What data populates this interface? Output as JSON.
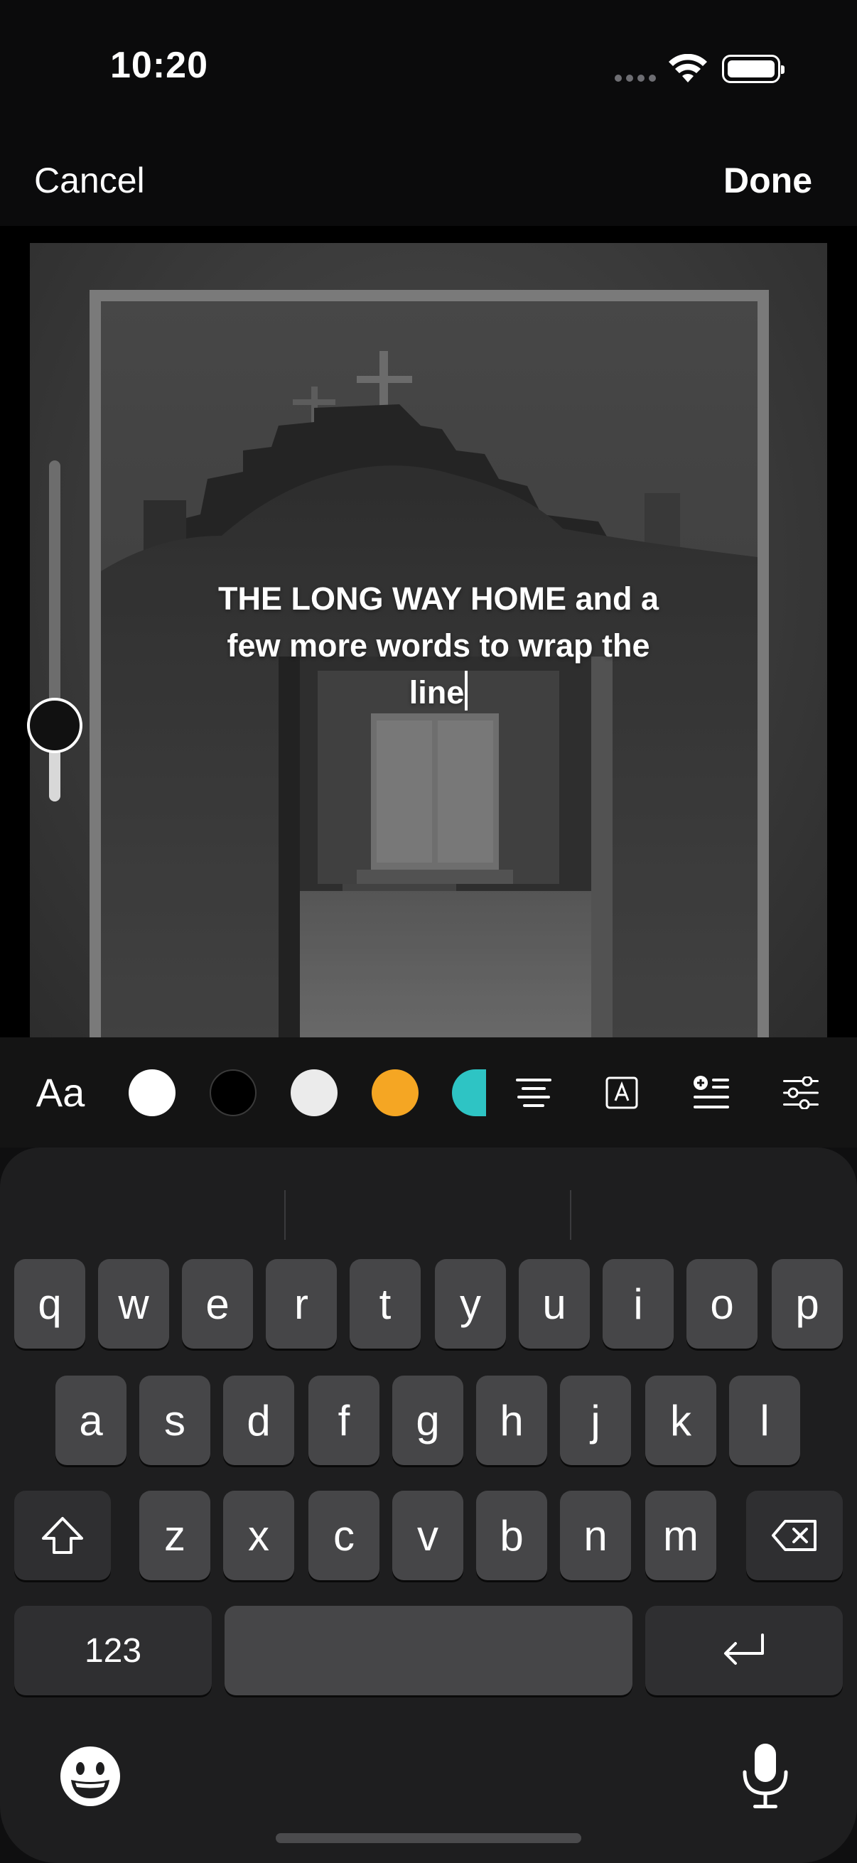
{
  "status_bar": {
    "time": "10:20",
    "icons": [
      "signal-dots-icon",
      "wifi-icon",
      "battery-icon"
    ]
  },
  "nav": {
    "cancel_label": "Cancel",
    "done_label": "Done"
  },
  "editor": {
    "text_line_1": "THE LONG WAY HOME and a",
    "text_line_2": "few more words to wrap the",
    "text_line_3": "line",
    "text_size_level": 0.17
  },
  "toolbar": {
    "font_label": "Aa",
    "colors": [
      {
        "name": "white",
        "hex": "#ffffff"
      },
      {
        "name": "black",
        "hex": "#000000"
      },
      {
        "name": "light-gray",
        "hex": "#ebebeb"
      },
      {
        "name": "orange",
        "hex": "#f5a623"
      },
      {
        "name": "teal",
        "hex": "#2ec4c4"
      }
    ],
    "icons": [
      "align-center-icon",
      "text-background-icon",
      "add-line-icon",
      "sliders-icon"
    ]
  },
  "keyboard": {
    "row1": [
      "q",
      "w",
      "e",
      "r",
      "t",
      "y",
      "u",
      "i",
      "o",
      "p"
    ],
    "row2": [
      "a",
      "s",
      "d",
      "f",
      "g",
      "h",
      "j",
      "k",
      "l"
    ],
    "row3": [
      "z",
      "x",
      "c",
      "v",
      "b",
      "n",
      "m"
    ],
    "numbers_label": "123",
    "icons": [
      "shift-icon",
      "backspace-icon",
      "return-icon",
      "emoji-icon",
      "microphone-icon"
    ]
  }
}
